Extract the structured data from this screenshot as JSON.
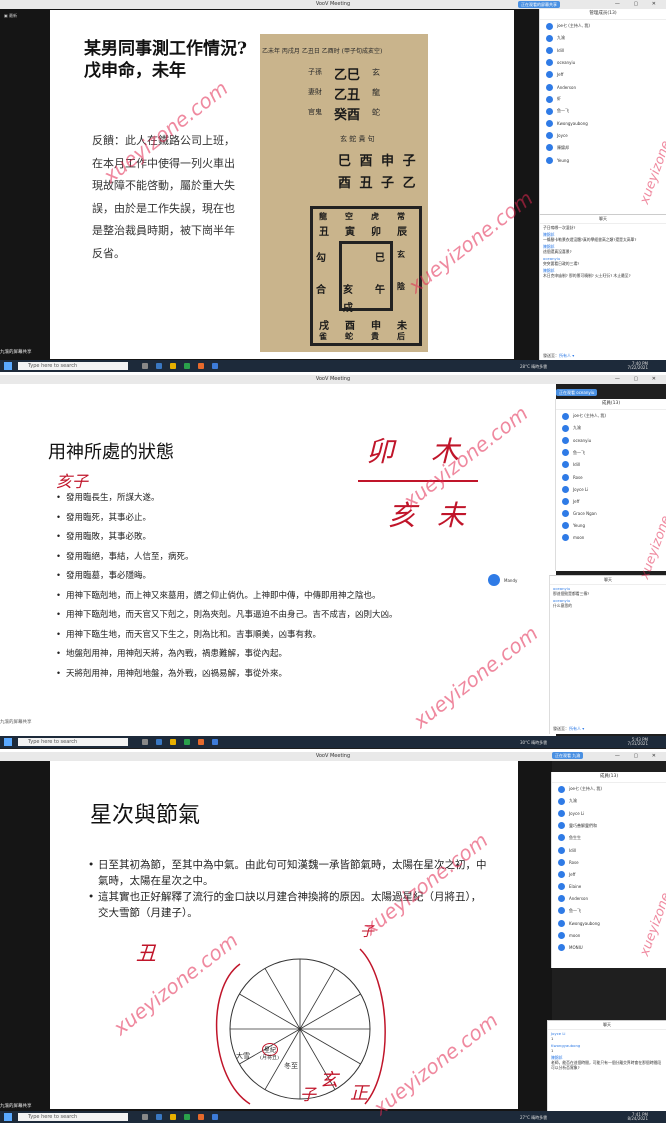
{
  "window_title": "VooV Meeting",
  "watermark": "xueyizone.com",
  "taskbar": {
    "search_placeholder": "Type here to search"
  },
  "screen1": {
    "share_status": "正在观看的屏幕共享",
    "speaker_chip": "九渝的屏幕共享",
    "participants_header": "管理成员(13)",
    "members": [
      "joe七 (主持人, 我)",
      "九渝",
      "Idill",
      "oceanyiu",
      "Jeff",
      "Anderson",
      "虾",
      "鱼一飞",
      "Kwongyaubong",
      "Joyce",
      "陳錦邦",
      "Yeung"
    ],
    "chat_header": "聊天",
    "chat": [
      {
        "name": "",
        "text": "子日嗚哪一次湿卦?"
      },
      {
        "name": "陳錦邦",
        "text": "一條腳卡勒景衣燈沒體?真的學經書高之類?還是太高單?"
      },
      {
        "name": "陳錦邦",
        "text": "這個還真沒喜景?"
      },
      {
        "name": "oceanyiu",
        "text": "突突要看日政的三場?"
      },
      {
        "name": "陳錦邦",
        "text": "木日克申庙制? 那的景可曉制? 火土旺衍? 木止最至?"
      }
    ],
    "chat_footer_label": "發送至：",
    "chat_footer_target": "所有人",
    "slide": {
      "title_line1": "某男同事測工作情況?",
      "title_line2": "戊申命，未年",
      "body": "反饋：此人在鐵路公司上班，在本月工作中使得一列火車出現故障不能啓動，屬於重大失誤，由於是工作失誤，現在也是整治裁員時期，被下崗半年反省。",
      "board_header": "乙未年 丙戌月 乙丑日 乙酉时 (甲子旬成亥空)",
      "board_rows": [
        [
          "子孫",
          "乙巳",
          "玄"
        ],
        [
          "妻財",
          "乙丑",
          "龍"
        ],
        [
          "官鬼",
          "癸酉",
          "蛇"
        ]
      ],
      "board_mid_labels": "玄 蛇 貴 句",
      "board_chars_top": "巳 酉 申 子",
      "board_chars_bottom": "酉 丑 子 乙",
      "grid_top": [
        "龍",
        "空",
        "虎",
        "常"
      ],
      "grid_top2": [
        "丑",
        "寅",
        "卯",
        "辰"
      ],
      "grid_left": [
        "勾",
        "合",
        "亥",
        "戌"
      ],
      "grid_right": [
        "巳",
        "玄",
        "午",
        "陰"
      ],
      "grid_bottom": [
        "戌",
        "酉",
        "申",
        "未"
      ],
      "grid_bottom2": [
        "雀",
        "蛇",
        "貴",
        "后"
      ]
    },
    "tray": {
      "weather": "28°C 晴時多雲",
      "time": "7:40 PM",
      "date": "7/22/2021"
    }
  },
  "screen2": {
    "share_status": "正在观看 oceanyiu",
    "speaker_chip": "九渝的屏幕共享",
    "participants_header": "成員(13)",
    "members": [
      "joe七 (主持人, 我)",
      "九渝",
      "oceanyiu",
      "鱼一飞",
      "Idill",
      "Rose",
      "Joyce Li",
      "Jeff",
      "Grace Ngan",
      "Yeung",
      "moon"
    ],
    "mandy_label": "Mandy",
    "chat_header": "聊天",
    "chat": [
      {
        "name": "oceanyiu",
        "text": "那這個勁是都看三傳?"
      },
      {
        "name": "oceanyiu",
        "text": "什么意思的"
      }
    ],
    "chat_footer_label": "發送至：",
    "chat_footer_target": "所有人",
    "slide": {
      "title": "用神所處的狀態",
      "bullets": [
        "發用臨長生，所謀大遂。",
        "發用臨死，其事必止。",
        "發用臨敗，其事必敗。",
        "發用臨絕，事結，人信至，病死。",
        "發用臨墓，事必隱晦。",
        "用神下臨剋地，而上神又來墓用，謂之仰止倘仇。上神即中傳，中傳即用神之陰也。",
        "用神下臨剋地，而天官又下剋之，則為夾剋。凡事逼迫不由身己。吉不成吉，凶則大凶。",
        "用神下臨生地，而天官又下生之，則為比和。吉事順美，凶事有救。",
        "地盤剋用神，用神剋天將，為內戰，禍患難解，事從內起。",
        "天將剋用神，用神剋地盤，為外戰，凶禍易解，事從外來。"
      ],
      "annotation_left": "亥子",
      "annotation_right_1": "卯 木",
      "annotation_right_2": "亥 未"
    },
    "tray": {
      "weather": "30°C 晴時多雲",
      "time": "5:43 PM",
      "date": "7/31/2021"
    }
  },
  "screen3": {
    "share_status": "正在观看 九渝",
    "speaker_chip": "九渝的屏幕共享",
    "participants_header": "成員(13)",
    "members": [
      "joe七 (主持人, 我)",
      "九渝",
      "Joyce Li",
      "靈巧善解靈們和",
      "鱼生生",
      "Idill",
      "Rose",
      "Jeff",
      "Elaine",
      "Anderson",
      "鱼一飞",
      "Kwongyaubong",
      "moon",
      "MONIU"
    ],
    "chat_header": "聊天",
    "chat": [
      {
        "name": "Joyce Li",
        "text": "1"
      },
      {
        "name": "Kwongyaubong",
        "text": "1"
      },
      {
        "name": "陳錦邦",
        "text": "老師，能否在這個時間，可能只有一個分離交界時會在那個時間段可以分析否實象?"
      }
    ],
    "slide": {
      "title": "星次與節氣",
      "bullets": [
        "日至其初為節，至其中為中氣。由此句可知漢魏一承皆節氣時，太陽在星次之初，中氣時，太陽在星次之中。",
        "這其實也正好解釋了流行的金口訣以月建合神換將的原因。太陽過星紀（月將丑），交大雪節（月建子）。"
      ],
      "wheel_labels": [
        "大雪",
        "星紀",
        "冬至"
      ],
      "wheel_small": "(月将丑)",
      "annotations": [
        "丑",
        "子",
        "玄",
        "正",
        "子"
      ]
    },
    "tray": {
      "weather": "27°C 晴時多雲",
      "time": "7:41 PM",
      "date": "8/24/2021"
    }
  }
}
